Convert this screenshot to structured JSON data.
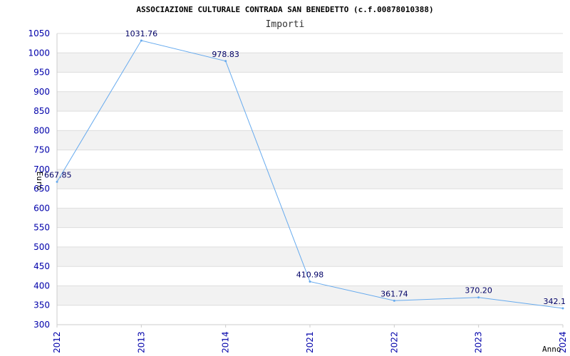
{
  "chart_data": {
    "type": "line",
    "title": "ASSOCIAZIONE CULTURALE CONTRADA SAN BENEDETTO (c.f.00878010388)",
    "subtitle": "Importi",
    "xlabel": "Anno",
    "ylabel": "Euro",
    "categories": [
      "2012",
      "2013",
      "2014",
      "2021",
      "2022",
      "2023",
      "2024"
    ],
    "series": [
      {
        "values": [
          667.85,
          1031.76,
          978.83,
          410.98,
          361.74,
          370.2,
          342.1
        ],
        "labels": [
          "667.85",
          "1031.76",
          "978.83",
          "410.98",
          "361.74",
          "370.20",
          "342.1"
        ]
      }
    ],
    "ylim": [
      300,
      1050
    ],
    "yticks": [
      300,
      350,
      400,
      450,
      500,
      550,
      600,
      650,
      700,
      750,
      800,
      850,
      900,
      950,
      1000,
      1050
    ],
    "grid": true,
    "colors": {
      "line": "#66aaee",
      "band_alt": "#f2f2f2",
      "gridline": "#dddddd",
      "tick_text": "#0000aa",
      "data_label": "#000066"
    }
  }
}
